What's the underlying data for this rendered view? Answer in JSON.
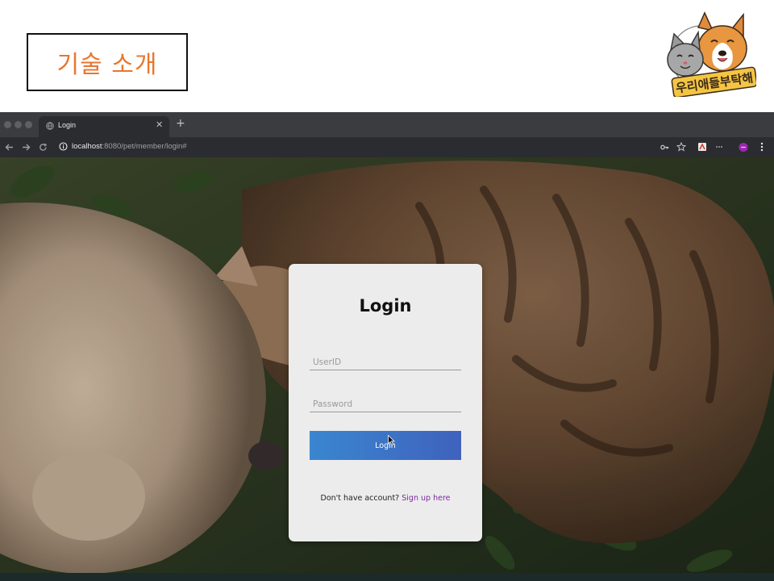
{
  "slide": {
    "title": "기술 소개",
    "logo_text": "우리애들부탁해"
  },
  "browser": {
    "tab_title": "Login",
    "url_host": "localhost",
    "url_path": ":8080/pet/member/login#"
  },
  "login": {
    "title": "Login",
    "userid_placeholder": "UserID",
    "password_placeholder": "Password",
    "button_label": "Login",
    "signup_prompt": "Don't have account?",
    "signup_link": "Sign up here"
  },
  "colors": {
    "slide_title": "#e8772e",
    "button_start": "#3a86d0",
    "button_end": "#3f62bd",
    "signup_link": "#7a2aa0",
    "profile_badge": "#9c27b0"
  }
}
